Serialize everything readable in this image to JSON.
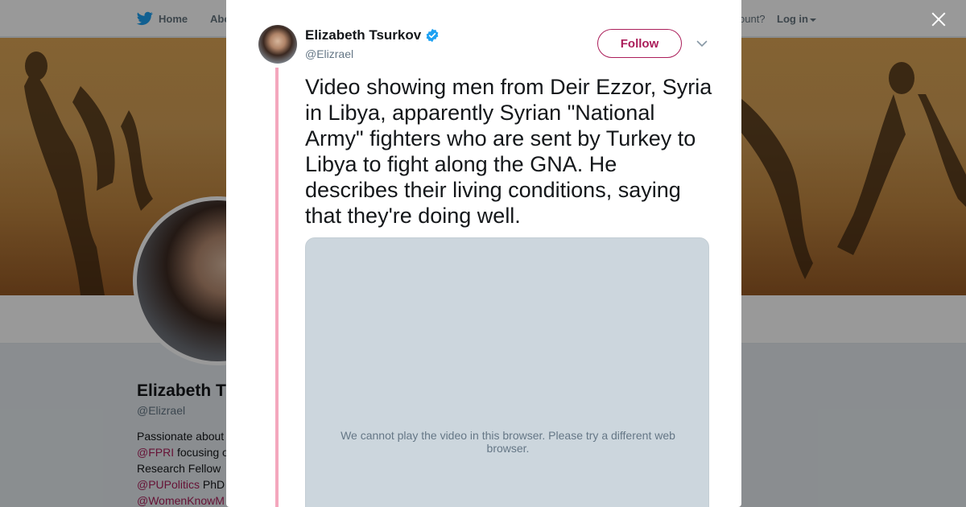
{
  "topbar": {
    "home_label": "Home",
    "about_label": "Abo",
    "account_label": "ccount?",
    "login_label": "Log in"
  },
  "profile": {
    "name": "Elizabeth T",
    "handle": "@Elizrael",
    "bio": [
      {
        "link": "",
        "text": "Passionate about"
      },
      {
        "link": "@FPRI",
        "text": " focusing o"
      },
      {
        "link": "",
        "text": "Research Fellow"
      },
      {
        "link": "@PUPolitics",
        "text": " PhD"
      },
      {
        "link": "@WomenKnowM",
        "text": ""
      }
    ]
  },
  "tweet": {
    "author_name": "Elizabeth Tsurkov",
    "author_handle": "@Elizrael",
    "verified": true,
    "follow_label": "Follow",
    "text": "Video showing men from Deir Ezzor, Syria in Libya, apparently Syrian \"National Army\" fighters who are sent by Turkey to Libya to fight along the GNA. He describes their living conditions, saying that they're doing well.",
    "video_message": "We cannot play the video in this browser. Please try a different web browser."
  },
  "colors": {
    "accent": "#ab1e5a",
    "thread_line": "#f4a7bd",
    "verified_blue": "#1da1f2",
    "video_bg": "#ccd6dd"
  },
  "icons": [
    "twitter-bird-icon",
    "caret-down-icon",
    "close-icon",
    "verified-badge-icon",
    "chevron-down-icon"
  ]
}
